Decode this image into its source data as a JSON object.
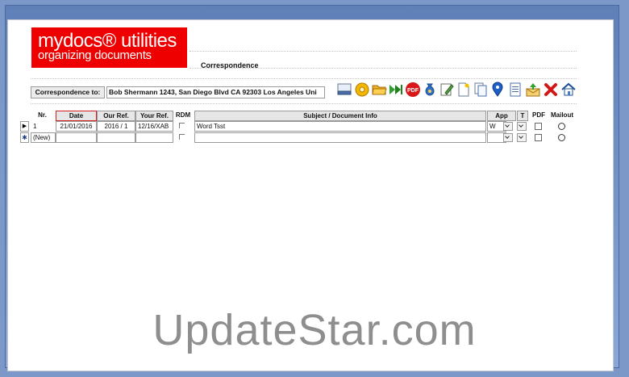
{
  "logo": {
    "line1": "mydocs® utilities",
    "line2": "organizing documents"
  },
  "form_title": "Correspondence",
  "correspondence_to": {
    "label": "Correspondence to:",
    "value": "Bob Shermann 1243, San Diego Blvd CA 92303 Los Angeles Uni"
  },
  "toolbar": [
    "scanner-icon",
    "settings-icon",
    "folder-open-icon",
    "forward-icon",
    "pdf-icon",
    "money-bag-icon",
    "edit-note-icon",
    "new-document-icon",
    "copy-documents-icon",
    "location-pin-icon",
    "document-icon",
    "send-mail-icon",
    "delete-icon",
    "home-icon"
  ],
  "columns": {
    "nr": "Nr.",
    "date": "Date",
    "our_ref": "Our Ref.",
    "your_ref": "Your Ref.",
    "rdm": "RDM",
    "subject": "Subject / Document Info",
    "app": "App",
    "t": "T",
    "pdf": "PDF",
    "mailout": "Mailout"
  },
  "rows": [
    {
      "selector": "▶",
      "nr": "1",
      "date": "21/01/2016",
      "our_ref": "2016 / 1",
      "your_ref": "12/16/XAB",
      "subject": "Word Tsst",
      "app": "W"
    },
    {
      "selector": "✱",
      "nr": "(New)",
      "date": "",
      "our_ref": "",
      "your_ref": "",
      "subject": "",
      "app": ""
    }
  ],
  "colors": {
    "logo_bg": "#ee0000",
    "page_bg": "#ffffff",
    "frame_bg": "#7c98c8"
  },
  "watermark": "UpdateStar.com"
}
